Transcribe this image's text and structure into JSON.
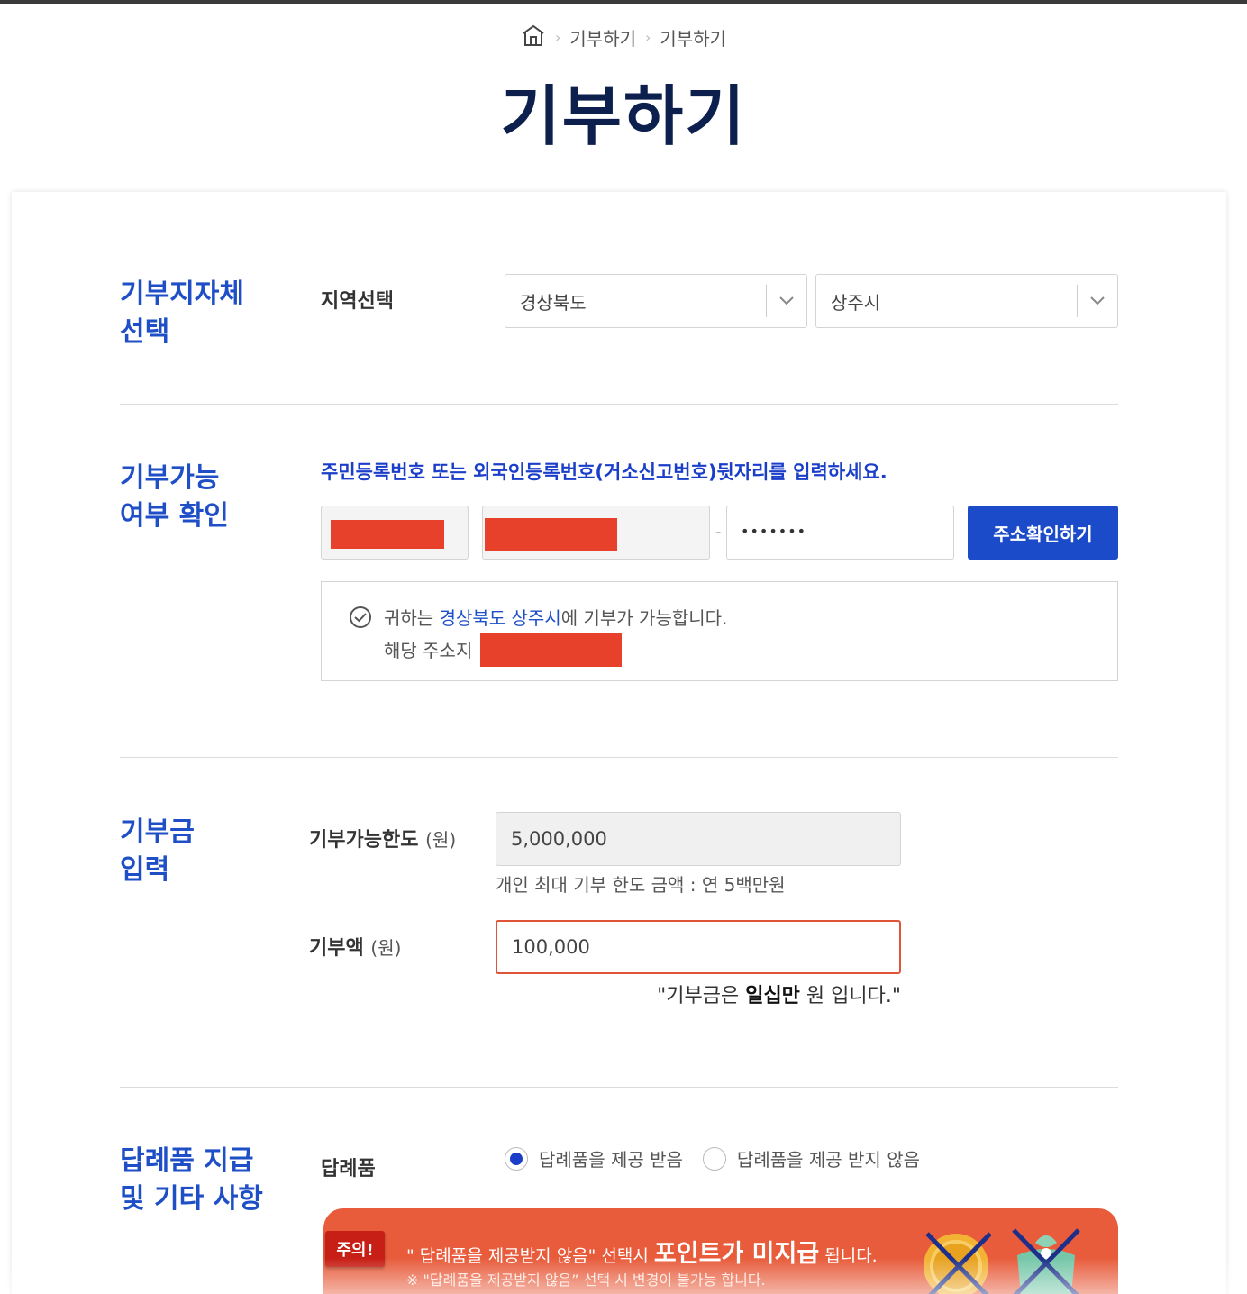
{
  "breadcrumb": {
    "items": [
      "기부하기",
      "기부하기"
    ]
  },
  "page": {
    "title": "기부하기"
  },
  "region": {
    "title": "기부지자체\n선택",
    "label": "지역선택",
    "province": "경상북도",
    "city": "상주시"
  },
  "eligibility": {
    "title": "기부가능\n여부 확인",
    "instruction": "주민등록번호 또는 외국인등록번호(거소신고번호)뒷자리를 입력하세요.",
    "separator": "-",
    "password_mask": "•••••••",
    "button": "주소확인하기",
    "result": {
      "prefix": "귀하는 ",
      "highlight": "경상북도 상주시",
      "suffix": "에 기부가 가능합니다.",
      "address_label": "해당 주소지 :"
    }
  },
  "amount": {
    "title": "기부금\n입력",
    "limit_label": "기부가능한도",
    "limit_unit": "(원)",
    "limit_value": "5,000,000",
    "limit_hint": "개인 최대 기부 한도 금액 : 연 5백만원",
    "donation_label": "기부액",
    "donation_unit": "(원)",
    "donation_value": "100,000",
    "amount_prefix": "\"기부금은 ",
    "amount_words": "일십만",
    "amount_suffix": " 원 입니다.\""
  },
  "gift": {
    "title": "답례품 지급\n및 기타 사항",
    "label": "답례품",
    "option_receive": "답례품을 제공 받음",
    "option_decline": "답례품을 제공 받지 않음",
    "selected": "receive"
  },
  "notice": {
    "badge": "주의!",
    "main_prefix": "\" 답례품을 제공받지 않음\" 선택시 ",
    "main_emphasis": "포인트가 미지급",
    "main_suffix": " 됩니다.",
    "sub": "※ \"답례품을 제공받지 않음” 선택 시 변경이 불가능 합니다."
  },
  "colors": {
    "title_navy": "#0c1f4d",
    "accent_blue": "#1e4fc7",
    "button_blue": "#1b4bc8",
    "notice_orange": "#e85c3c",
    "redaction_red": "#e8412b"
  }
}
